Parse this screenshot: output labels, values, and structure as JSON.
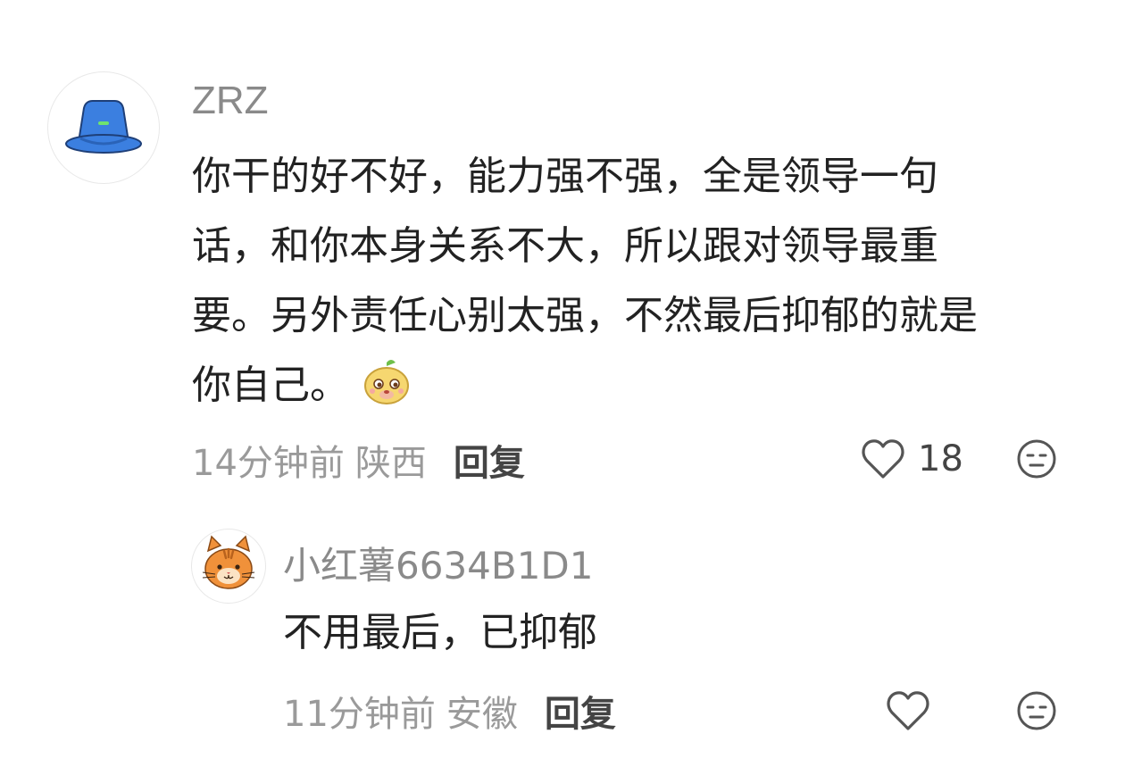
{
  "comments": [
    {
      "username": "ZRZ",
      "text_lines": [
        "你干的好不好，能力强不强，全是领导一句",
        "话，和你本身关系不大，所以跟对领导最重",
        "要。另外责任心别太强，不然最后抑郁的就是",
        "你自己。"
      ],
      "time": "14分钟前",
      "location": "陕西",
      "reply_label": "回复",
      "like_count": "18",
      "avatar_icon": "blue-bucket-hat-icon",
      "inline_emoji": "cute-mascot-emoji-icon"
    },
    {
      "username": "小红薯6634B1D1",
      "text_lines": [
        "不用最后，已抑郁"
      ],
      "time": "11分钟前",
      "location": "安徽",
      "reply_label": "回复",
      "like_count": "",
      "avatar_icon": "orange-cat-icon"
    }
  ],
  "colors": {
    "username": "#8a8a8a",
    "text": "#222222",
    "meta": "#9a9a9a",
    "icon_stroke": "#555555",
    "hat_blue": "#3b7fe0"
  }
}
